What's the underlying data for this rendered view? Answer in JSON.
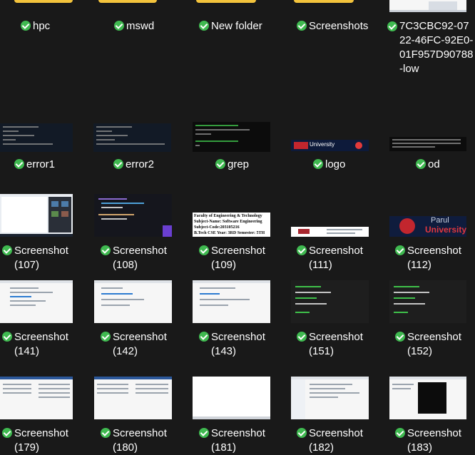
{
  "colors": {
    "background": "#191919",
    "check": "#3fb950",
    "folder": "#f3c33c",
    "text": "#ffffff"
  },
  "rows": [
    {
      "items": [
        {
          "name": "hpc",
          "kind": "folder"
        },
        {
          "name": "mswd",
          "kind": "folder"
        },
        {
          "name": "New folder",
          "kind": "folder"
        },
        {
          "name": "Screenshots",
          "kind": "folder"
        },
        {
          "name": "7C3CBC92-0722-46FC-92E0-01F957D90788-low",
          "kind": "image"
        }
      ]
    },
    {
      "items": [
        {
          "name": "error1",
          "kind": "terminal"
        },
        {
          "name": "error2",
          "kind": "terminal"
        },
        {
          "name": "grep",
          "kind": "terminal"
        },
        {
          "name": "logo",
          "kind": "logo"
        },
        {
          "name": "od",
          "kind": "terminal"
        }
      ]
    },
    {
      "items": [
        {
          "name": "Screenshot",
          "sub": "(107)"
        },
        {
          "name": "Screenshot",
          "sub": "(108)"
        },
        {
          "name": "Screenshot",
          "sub": "(109)"
        },
        {
          "name": "Screenshot",
          "sub": "(111)"
        },
        {
          "name": "Screenshot",
          "sub": "(112)"
        }
      ]
    },
    {
      "items": [
        {
          "name": "Screenshot",
          "sub": "(141)"
        },
        {
          "name": "Screenshot",
          "sub": "(142)"
        },
        {
          "name": "Screenshot",
          "sub": "(143)"
        },
        {
          "name": "Screenshot",
          "sub": "(151)"
        },
        {
          "name": "Screenshot",
          "sub": "(152)"
        }
      ]
    },
    {
      "items": [
        {
          "name": "Screenshot",
          "sub": "(179)"
        },
        {
          "name": "Screenshot",
          "sub": "(180)"
        },
        {
          "name": "Screenshot",
          "sub": "(181)"
        },
        {
          "name": "Screenshot",
          "sub": "(182)"
        },
        {
          "name": "Screenshot",
          "sub": "(183)"
        }
      ]
    }
  ],
  "thumb_text": {
    "error1_lines": [
      "Enter the Username:",
      "xuname",
      "Enter the password:",
      "12345",
      "Password is less than 8 characters"
    ],
    "error2_lines": [
      "Enter the Username:",
      "xuname",
      "Enter the password:",
      "password",
      "Entered password is missing special characters"
    ],
    "grep_lines": [
      "kals@DESKTOP MINGW64 ~/Labs",
      "$ cat dog.txt | grep \"dog\"",
      "no dog",
      "kals@DESKTOP MINGW64 ~/Labs",
      "$"
    ],
    "logo_text": "University",
    "s109_lines": [
      "Faculty of Engineering & Technology",
      "Subject-Name: Software Engineering",
      "Subject-Code:203105216",
      "B.Tech CSE Year: 3RD Semester: 5TH"
    ],
    "s112_brand": "Parul",
    "s112_text": "University"
  }
}
